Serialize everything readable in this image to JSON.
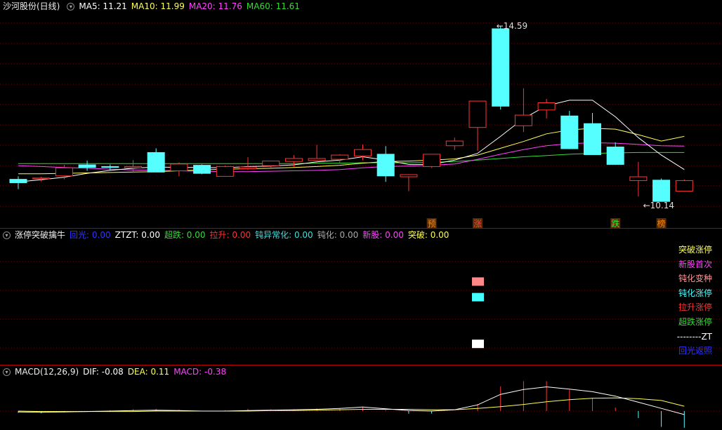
{
  "price_panel": {
    "title": "沙河股份(日线)",
    "ma_labels": [
      {
        "text": "MA5: 11.21",
        "color": "#ffffff"
      },
      {
        "text": "MA10: 11.99",
        "color": "#ffff55"
      },
      {
        "text": "MA20: 11.76",
        "color": "#ff44ff"
      },
      {
        "text": "MA60: 11.61",
        "color": "#33dd33"
      }
    ],
    "high_label": "14.59",
    "low_label": "←10.14",
    "markers": [
      {
        "text": "预",
        "color": "#ff8800"
      },
      {
        "text": "涨",
        "color": "#ff4444"
      },
      {
        "text": "跌",
        "color": "#33ee33"
      },
      {
        "text": "榜",
        "color": "#ff8800"
      }
    ]
  },
  "indicator_panel": {
    "title": "涨停突破擒牛",
    "labels": [
      {
        "text": "回光: 0.00",
        "color": "#3333ff"
      },
      {
        "text": "ZTZT: 0.00",
        "color": "#ffffff"
      },
      {
        "text": "超跌: 0.00",
        "color": "#33dd33"
      },
      {
        "text": "拉升: 0.00",
        "color": "#ff3333"
      },
      {
        "text": "钝异常化: 0.00",
        "color": "#44dddd"
      },
      {
        "text": "钝化: 0.00",
        "color": "#aaaaaa"
      },
      {
        "text": "新股: 0.00",
        "color": "#ff44ff"
      },
      {
        "text": "突破: 0.00",
        "color": "#ffff55"
      }
    ],
    "legend": [
      {
        "text": "突破涨停",
        "color": "#ffff55"
      },
      {
        "text": "新股首次",
        "color": "#ff44ff"
      },
      {
        "text": "钝化变种",
        "color": "#ff9999"
      },
      {
        "text": "钝化涨停",
        "color": "#44ffff"
      },
      {
        "text": "拉升涨停",
        "color": "#ff3333"
      },
      {
        "text": "超跌涨停",
        "color": "#33dd33"
      },
      {
        "text": "--------ZT",
        "color": "#ffffff"
      },
      {
        "text": "回光返照",
        "color": "#3333ff"
      }
    ]
  },
  "macd_panel": {
    "title": "MACD(12,26,9)",
    "labels": [
      {
        "text": "DIF: -0.08",
        "color": "#ffffff"
      },
      {
        "text": "DEA: 0.11",
        "color": "#ffff55"
      },
      {
        "text": "MACD: -0.38",
        "color": "#ff44ff"
      }
    ]
  },
  "chart_data": {
    "type": "candlestick",
    "candles": [
      {
        "o": 10.98,
        "c": 10.9,
        "h": 11.05,
        "l": 10.75
      },
      {
        "o": 10.99,
        "c": 11.01,
        "h": 11.04,
        "l": 10.93
      },
      {
        "o": 11.06,
        "c": 11.25,
        "h": 11.32,
        "l": 10.98
      },
      {
        "o": 11.32,
        "c": 11.26,
        "h": 11.42,
        "l": 11.18
      },
      {
        "o": 11.28,
        "c": 11.26,
        "h": 11.33,
        "l": 11.2
      },
      {
        "o": 11.25,
        "c": 11.28,
        "h": 11.43,
        "l": 11.13
      },
      {
        "o": 11.61,
        "c": 11.15,
        "h": 11.71,
        "l": 11.15
      },
      {
        "o": 11.18,
        "c": 11.34,
        "h": 11.38,
        "l": 11.05
      },
      {
        "o": 11.31,
        "c": 11.12,
        "h": 11.33,
        "l": 11.1
      },
      {
        "o": 11.05,
        "c": 11.28,
        "h": 11.3,
        "l": 11.05
      },
      {
        "o": 11.23,
        "c": 11.27,
        "h": 11.5,
        "l": 11.2
      },
      {
        "o": 11.3,
        "c": 11.41,
        "h": 11.42,
        "l": 11.22
      },
      {
        "o": 11.4,
        "c": 11.47,
        "h": 11.55,
        "l": 11.28
      },
      {
        "o": 11.42,
        "c": 11.47,
        "h": 11.79,
        "l": 11.36
      },
      {
        "o": 11.45,
        "c": 11.55,
        "h": 11.57,
        "l": 11.37
      },
      {
        "o": 11.53,
        "c": 11.68,
        "h": 11.8,
        "l": 11.43
      },
      {
        "o": 11.57,
        "c": 11.06,
        "h": 11.76,
        "l": 10.92
      },
      {
        "o": 11.04,
        "c": 11.09,
        "h": 11.1,
        "l": 10.7
      },
      {
        "o": 11.28,
        "c": 11.57,
        "h": 11.57,
        "l": 11.25
      },
      {
        "o": 11.77,
        "c": 11.88,
        "h": 11.96,
        "l": 11.67
      },
      {
        "o": 12.2,
        "c": 12.82,
        "h": 12.82,
        "l": 11.65
      },
      {
        "o": 14.52,
        "c": 12.7,
        "h": 14.59,
        "l": 12.62
      },
      {
        "o": 12.24,
        "c": 12.49,
        "h": 13.12,
        "l": 12.09
      },
      {
        "o": 12.61,
        "c": 12.78,
        "h": 12.87,
        "l": 12.41
      },
      {
        "o": 12.47,
        "c": 11.7,
        "h": 12.59,
        "l": 11.69
      },
      {
        "o": 12.29,
        "c": 11.56,
        "h": 12.54,
        "l": 11.56
      },
      {
        "o": 11.74,
        "c": 11.33,
        "h": 11.85,
        "l": 11.33
      },
      {
        "o": 10.95,
        "c": 11.04,
        "h": 11.39,
        "l": 10.58
      },
      {
        "o": 10.96,
        "c": 10.46,
        "h": 11.0,
        "l": 10.46
      },
      {
        "o": 10.7,
        "c": 10.95,
        "h": 10.98,
        "l": 10.7
      }
    ],
    "ma5": [
      10.92,
      10.97,
      11.03,
      11.12,
      11.19,
      11.24,
      11.27,
      11.26,
      11.26,
      11.25,
      11.28,
      11.29,
      11.32,
      11.39,
      11.43,
      11.51,
      11.43,
      11.33,
      11.33,
      11.43,
      11.59,
      11.99,
      12.41,
      12.71,
      12.84,
      12.84,
      12.45,
      11.96,
      11.55,
      11.21
    ],
    "ma10": [
      11.11,
      11.11,
      11.12,
      11.13,
      11.14,
      11.15,
      11.16,
      11.18,
      11.2,
      11.22,
      11.23,
      11.24,
      11.26,
      11.28,
      11.31,
      11.36,
      11.4,
      11.41,
      11.43,
      11.46,
      11.55,
      11.71,
      11.87,
      12.05,
      12.14,
      12.18,
      12.16,
      12.03,
      11.88,
      11.99
    ],
    "ma20": [
      11.3,
      11.28,
      11.26,
      11.24,
      11.22,
      11.2,
      11.19,
      11.18,
      11.17,
      11.16,
      11.16,
      11.17,
      11.18,
      11.19,
      11.21,
      11.25,
      11.28,
      11.29,
      11.31,
      11.34,
      11.45,
      11.57,
      11.68,
      11.77,
      11.82,
      11.84,
      11.83,
      11.8,
      11.77,
      11.76
    ],
    "ma60": [
      11.35,
      11.35,
      11.35,
      11.35,
      11.35,
      11.35,
      11.35,
      11.35,
      11.35,
      11.35,
      11.35,
      11.35,
      11.35,
      11.36,
      11.36,
      11.37,
      11.37,
      11.37,
      11.38,
      11.4,
      11.43,
      11.47,
      11.51,
      11.54,
      11.57,
      11.59,
      11.6,
      11.61,
      11.61,
      11.61
    ],
    "price_range": [
      10.05,
      14.9
    ],
    "macd": {
      "dif": [
        -0.02,
        -0.03,
        -0.02,
        -0.01,
        0.0,
        0.01,
        0.02,
        0.01,
        0.0,
        0.0,
        0.01,
        0.02,
        0.03,
        0.04,
        0.06,
        0.09,
        0.05,
        0.01,
        0.0,
        0.03,
        0.14,
        0.38,
        0.49,
        0.55,
        0.5,
        0.44,
        0.34,
        0.2,
        0.06,
        -0.08
      ],
      "dea": [
        0.0,
        -0.01,
        -0.01,
        -0.01,
        -0.01,
        -0.01,
        0.0,
        0.0,
        0.0,
        0.0,
        0.0,
        0.01,
        0.01,
        0.02,
        0.03,
        0.04,
        0.04,
        0.04,
        0.03,
        0.03,
        0.06,
        0.1,
        0.15,
        0.21,
        0.26,
        0.29,
        0.3,
        0.28,
        0.24,
        0.11
      ],
      "hist": [
        -0.04,
        -0.05,
        -0.03,
        0.0,
        0.02,
        0.04,
        0.05,
        0.03,
        0.0,
        0.02,
        0.05,
        0.04,
        0.04,
        0.06,
        0.06,
        0.1,
        0.02,
        -0.06,
        -0.06,
        0.0,
        0.16,
        0.56,
        0.68,
        0.68,
        0.48,
        0.3,
        0.08,
        -0.16,
        -0.36,
        -0.38
      ],
      "range": [
        -0.4,
        0.75
      ]
    },
    "signals": [
      {
        "index": 20,
        "row": 2,
        "color": "#ff8888"
      },
      {
        "index": 20,
        "row": 3,
        "color": "#44ffff"
      },
      {
        "index": 20,
        "row": 6,
        "color": "#ffffff"
      }
    ]
  }
}
